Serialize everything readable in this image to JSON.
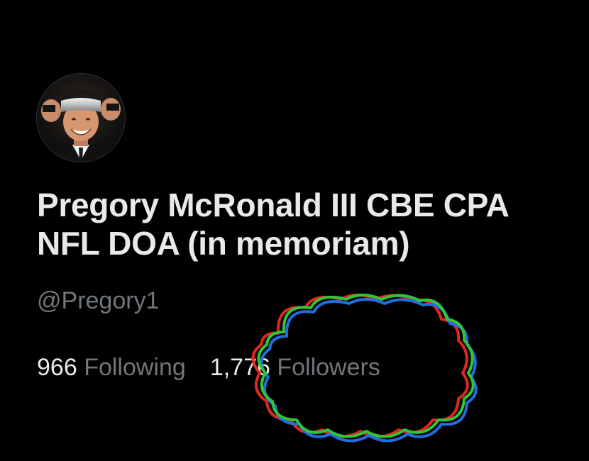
{
  "profile": {
    "display_name": "Pregory McRonald III CBE CPA NFL DOA (in memoriam)",
    "handle": "@Pregory1",
    "avatar_icon": "profile-photo"
  },
  "stats": {
    "following_count": "966",
    "following_label": "Following",
    "followers_count": "1,776",
    "followers_label": "Followers"
  },
  "annotation": {
    "shape": "cloud-scribble",
    "colors": [
      "#e0261f",
      "#2fc43a",
      "#1f6fe0"
    ]
  },
  "colors": {
    "background": "#000000",
    "primary_text": "#e7e9ea",
    "secondary_text": "#71767b"
  }
}
